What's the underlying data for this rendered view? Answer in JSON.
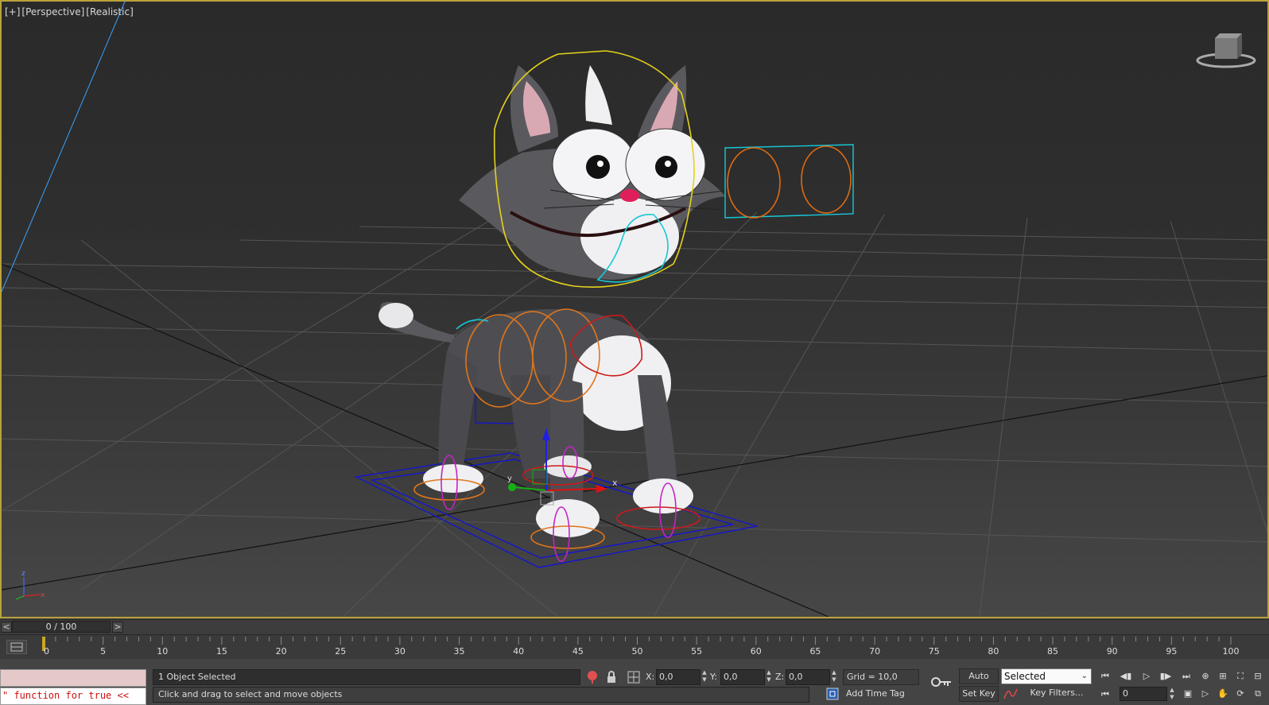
{
  "viewport": {
    "labels": [
      "[+]",
      "[Perspective]",
      "[Realistic]"
    ],
    "axis_gizmo": {
      "z": "z",
      "x": "x"
    },
    "move_gizmo": {
      "x": "x",
      "y": "y"
    }
  },
  "time_slider": {
    "prev": "<",
    "next": ">",
    "position": "0 / 100",
    "frame": 0,
    "total": 100
  },
  "trackbar": {
    "labels": [
      "0",
      "5",
      "10",
      "15",
      "20",
      "25",
      "30",
      "35",
      "40",
      "45",
      "50",
      "55",
      "60",
      "65",
      "70",
      "75",
      "80",
      "85",
      "90",
      "95",
      "100"
    ]
  },
  "listener": {
    "top": "",
    "bottom": "\" function for true <<"
  },
  "status": {
    "selection": "1 Object Selected",
    "prompt": "Click and drag to select and move objects"
  },
  "coords": {
    "x_label": "X:",
    "x_value": "0,0",
    "y_label": "Y:",
    "y_value": "0,0",
    "z_label": "Z:",
    "z_value": "0,0"
  },
  "grid": "Grid = 10,0",
  "add_time_tag": "Add Time Tag",
  "keys": {
    "auto_key": "Auto Key",
    "set_key": "Set Key",
    "selected_option": "Selected",
    "key_filters": "Key Filters...",
    "current_frame": "0"
  },
  "colors": {
    "viewport_border": "#b9a23a",
    "selection_box": "#1010c8",
    "head_ctrl": "#e6d21a",
    "eye_ctrl": "#e06a12",
    "spine_ctrl": "#e0751b",
    "chest_ctrl": "#cc1a1a",
    "foot_ctrl": "#c424c4",
    "jaw_ctrl": "#17c8d8"
  }
}
